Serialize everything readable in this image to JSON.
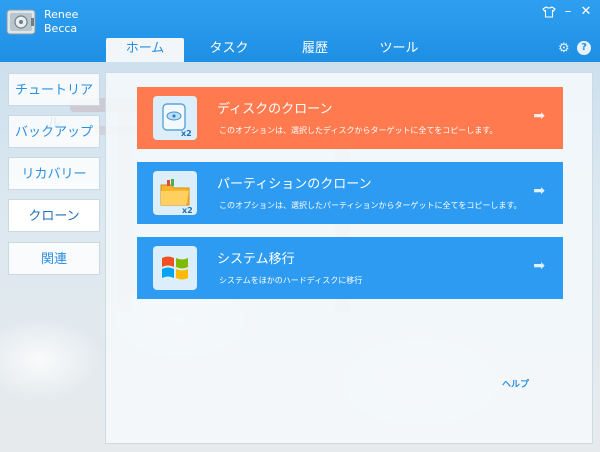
{
  "app": {
    "name_line1": "Renee",
    "name_line2": "Becca"
  },
  "window_controls": {
    "shirt_icon": "shirt-icon",
    "minimize": "–",
    "close": "✕"
  },
  "tabs": [
    {
      "label": "ホーム"
    },
    {
      "label": "タスク"
    },
    {
      "label": "履歴"
    },
    {
      "label": "ツール"
    }
  ],
  "toolbar": {
    "settings_glyph": "⚙",
    "help_glyph": "?"
  },
  "sidebar": {
    "items": [
      {
        "label": "チュートリアル"
      },
      {
        "label": "バックアップ"
      },
      {
        "label": "リカバリー"
      },
      {
        "label": "クローン"
      },
      {
        "label": "関連"
      }
    ]
  },
  "cards": [
    {
      "title": "ディスクのクローン",
      "desc": "このオプションは、選択したディスクからターゲットに全てをコピーします。",
      "badge": "x2",
      "color": "#ff7b4f"
    },
    {
      "title": "パーティションのクローン",
      "desc": "このオプションは、選択したパーティションからターゲットに全てをコピーします。",
      "badge": "x2",
      "color": "#2e9bf3"
    },
    {
      "title": "システム移行",
      "desc": "システムをほかのハードディスクに移行",
      "color": "#2e9bf3"
    }
  ],
  "footer": {
    "help_label": "ヘルプ"
  }
}
